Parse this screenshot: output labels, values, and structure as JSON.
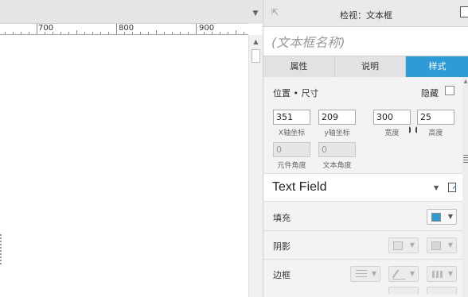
{
  "ruler": {
    "labels": [
      "700",
      "800",
      "900"
    ]
  },
  "panel": {
    "title": "检视：文本框",
    "name_placeholder": "(文本框名称)",
    "tabs": [
      {
        "label": "属性",
        "active": false
      },
      {
        "label": "说明",
        "active": false
      },
      {
        "label": "样式",
        "active": true
      }
    ],
    "accent_color": "#2e9bd6"
  },
  "position_size": {
    "section_label": "位置 • 尺寸",
    "hide_label": "隐藏",
    "hidden": false,
    "x": {
      "value": "351",
      "caption": "X轴坐标"
    },
    "y": {
      "value": "209",
      "caption": "y轴坐标"
    },
    "width": {
      "value": "300",
      "caption": "宽度"
    },
    "height": {
      "value": "25",
      "caption": "高度"
    },
    "element_angle": {
      "value": "0",
      "caption": "元件角度"
    },
    "text_angle": {
      "value": "0",
      "caption": "文本角度"
    }
  },
  "widget_type": {
    "label": "Text Field"
  },
  "styles": {
    "fill": {
      "label": "填充",
      "color": "#2e9bd6"
    },
    "shadow": {
      "label": "阴影"
    },
    "border": {
      "label": "边框"
    }
  }
}
